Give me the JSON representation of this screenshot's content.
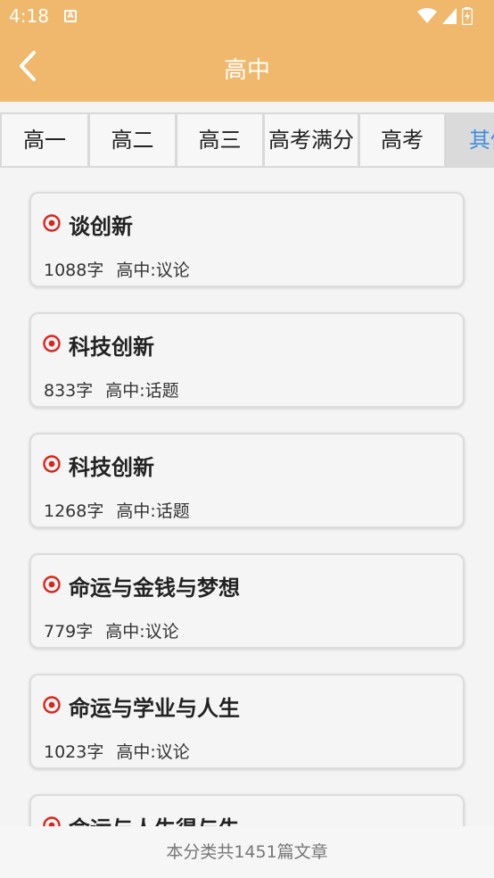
{
  "status_bar": {
    "time": "4:18",
    "notification_icon": "A"
  },
  "app_bar": {
    "title": "高中"
  },
  "tabs": [
    {
      "label": "高一",
      "active": false
    },
    {
      "label": "高二",
      "active": false
    },
    {
      "label": "高三",
      "active": false
    },
    {
      "label": "高考满分",
      "active": false
    },
    {
      "label": "高考",
      "active": false
    },
    {
      "label": "其他",
      "active": true
    }
  ],
  "articles": [
    {
      "title": "谈创新",
      "words": "1088字",
      "category": "高中:议论"
    },
    {
      "title": "科技创新",
      "words": "833字",
      "category": "高中:话题"
    },
    {
      "title": "科技创新",
      "words": "1268字",
      "category": "高中:话题"
    },
    {
      "title": "命运与金钱与梦想",
      "words": "779字",
      "category": "高中:议论"
    },
    {
      "title": "命运与学业与人生",
      "words": "1023字",
      "category": "高中:议论"
    },
    {
      "title": "命运与人生得与失",
      "words": "",
      "category": ""
    }
  ],
  "footer": {
    "text": "本分类共1451篇文章"
  },
  "colors": {
    "accent": "#efb86c",
    "active_tab_text": "#3f8ee0",
    "bullet": "#d9261c"
  }
}
